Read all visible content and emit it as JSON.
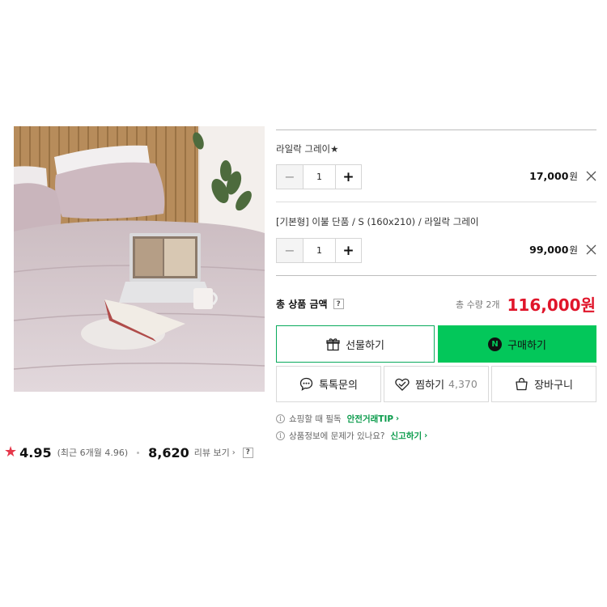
{
  "rating": {
    "score": "4.95",
    "recent": "(최근 6개월 4.96)",
    "review_count": "8,620",
    "review_link": "리뷰 보기",
    "help": "?"
  },
  "options": [
    {
      "name": "라일락 그레이★",
      "qty": "1",
      "price": "17,000",
      "unit": "원"
    },
    {
      "name": "[기본형] 이불 단품 / S (160x210) / 라일락 그레이",
      "qty": "1",
      "price": "99,000",
      "unit": "원"
    }
  ],
  "total": {
    "label": "총 상품 금액",
    "help": "?",
    "qty": "총 수량 2개",
    "price": "116,000원"
  },
  "buttons": {
    "gift": "선물하기",
    "buy": "구매하기",
    "buy_badge": "N",
    "talk": "톡톡문의",
    "zzim": "찜하기",
    "zzim_count": "4,370",
    "cart": "장바구니"
  },
  "notices": [
    {
      "text": "쇼핑할 때 필독",
      "link": "안전거래TIP"
    },
    {
      "text": "상품정보에 문제가 있나요?",
      "link": "신고하기"
    }
  ],
  "colors": {
    "accent_green": "#03c75a",
    "price_red": "#e0152a",
    "star_red": "#e5374a"
  }
}
